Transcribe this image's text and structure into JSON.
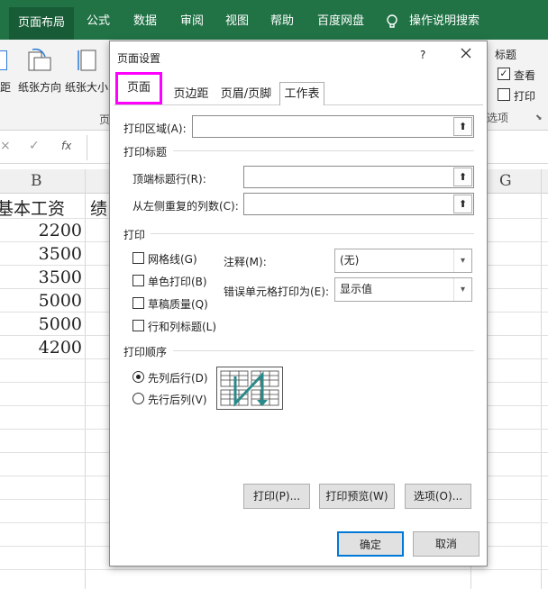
{
  "ribbon": {
    "tabs": [
      "页面布局",
      "公式",
      "数据",
      "审阅",
      "视图",
      "帮助",
      "百度网盘",
      "操作说明搜索"
    ],
    "active_tab": "页面布局",
    "buttons": {
      "margin_partial": "距",
      "orientation": "纸张方向",
      "size": "纸张大小",
      "group_partial": "页",
      "sheet_options_title": "标题",
      "view": "查看",
      "print": "打印",
      "options_partial": "选项"
    }
  },
  "formula_bar": {
    "x": "×",
    "check": "✓",
    "fx": "fx"
  },
  "sheet": {
    "col_b": "B",
    "col_g": "G",
    "header_b": "基本工资",
    "header_c_partial": "绩",
    "values": [
      "2200",
      "3500",
      "3500",
      "5000",
      "5000",
      "4200"
    ]
  },
  "dialog": {
    "title": "页面设置",
    "help": "?",
    "tabs": [
      "页面",
      "页边距",
      "页眉/页脚",
      "工作表"
    ],
    "print_area_label": "打印区域(A):",
    "print_titles_section": "打印标题",
    "rows_repeat_label": "顶端标题行(R):",
    "cols_repeat_label": "从左侧重复的列数(C):",
    "print_section": "打印",
    "gridlines": "网格线(G)",
    "black_white": "单色打印(B)",
    "draft": "草稿质量(Q)",
    "headings": "行和列标题(L)",
    "comments_label": "注释(M):",
    "comments_value": "(无)",
    "errors_label": "错误单元格打印为(E):",
    "errors_value": "显示值",
    "order_section": "打印顺序",
    "down_then_over": "先列后行(D)",
    "over_then_down": "先行后列(V)",
    "print_button": "打印(P)...",
    "preview_button": "打印预览(W)",
    "options_button": "选项(O)...",
    "ok_button": "确定",
    "cancel_button": "取消"
  },
  "colors": {
    "excel_green": "#217346",
    "highlight": "#ff00ff",
    "accent_blue": "#0078d7"
  }
}
